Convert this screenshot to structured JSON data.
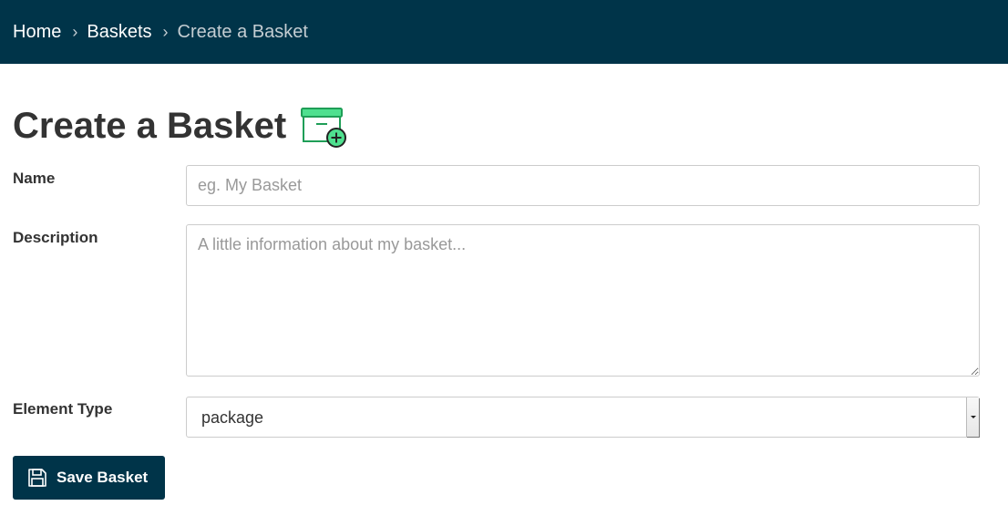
{
  "breadcrumb": {
    "items": [
      "Home",
      "Baskets",
      "Create a Basket"
    ],
    "separator": "›"
  },
  "page": {
    "title": "Create a Basket",
    "title_icon": "archive-add-icon"
  },
  "form": {
    "name": {
      "label": "Name",
      "placeholder": "eg. My Basket",
      "value": ""
    },
    "description": {
      "label": "Description",
      "placeholder": "A little information about my basket...",
      "value": ""
    },
    "element_type": {
      "label": "Element Type",
      "selected": "package"
    },
    "save_button": {
      "label": "Save Basket",
      "icon": "floppy-disk-icon"
    }
  },
  "colors": {
    "header_bg": "#003449",
    "accent_green": "#4fe08f",
    "text": "#333333"
  }
}
